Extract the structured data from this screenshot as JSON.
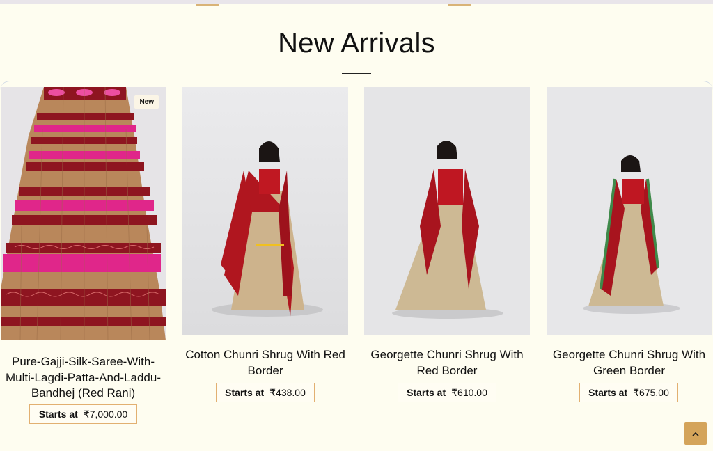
{
  "section": {
    "title": "New Arrivals"
  },
  "products": [
    {
      "name": "Pure-Gajji-Silk-Saree-With-Multi-Lagdi-Patta-And-Laddu-Bandhej (Red Rani)",
      "badge": "New",
      "price_label": "Starts at",
      "price": "₹7,000.00"
    },
    {
      "name": "Cotton Chunri Shrug With Red Border",
      "price_label": "Starts at",
      "price": "₹438.00"
    },
    {
      "name": "Georgette Chunri Shrug With Red Border",
      "price_label": "Starts at",
      "price": "₹610.00"
    },
    {
      "name": "Georgette Chunri Shrug With Green Border",
      "price_label": "Starts at",
      "price": "₹675.00"
    }
  ],
  "icons": {
    "scroll_top": "chevron-up-icon"
  },
  "colors": {
    "background": "#fefdf0",
    "accent": "#d4a45a",
    "price_border": "#e2b071"
  }
}
